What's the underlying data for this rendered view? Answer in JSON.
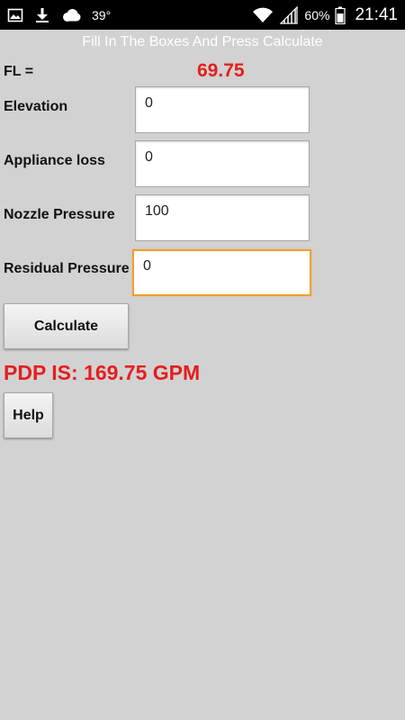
{
  "status_bar": {
    "temperature": "39°",
    "battery_percent": "60%",
    "time": "21:41",
    "left_icons": [
      "gallery-icon",
      "download-icon",
      "cloud-icon"
    ],
    "right_icons": [
      "wifi-icon",
      "signal-icon",
      "battery-icon"
    ]
  },
  "header": {
    "title": "Fill In The Boxes And Press Calculate"
  },
  "fl": {
    "label": "FL =",
    "value": "69.75"
  },
  "fields": [
    {
      "label": "Elevation",
      "value": "0"
    },
    {
      "label": "Appliance loss",
      "value": "0"
    },
    {
      "label": "Nozzle Pressure",
      "value": "100"
    },
    {
      "label": "Residual Pressure",
      "value": "0"
    }
  ],
  "buttons": {
    "calculate": "Calculate",
    "help": "Help"
  },
  "result": {
    "text": "PDP IS: 169.75 GPM"
  },
  "colors": {
    "background": "#d2d2d2",
    "result_red": "#e51e1e",
    "focus_orange": "#f0a030",
    "status_bar": "#000000"
  }
}
